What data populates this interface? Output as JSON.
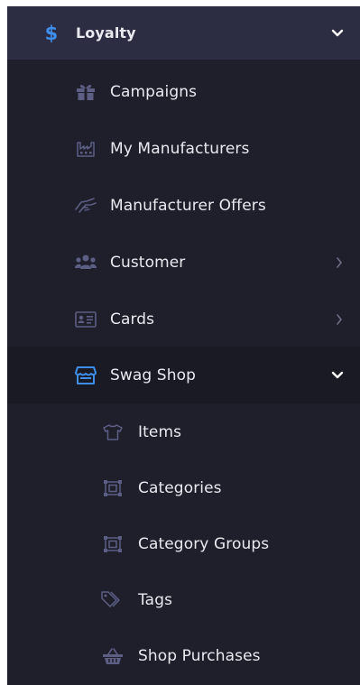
{
  "colors": {
    "panel_bg": "#1f1f2b",
    "header_bg": "#2c2c42",
    "selected_bg": "#1a1a25",
    "accent": "#3f8ee9",
    "icon_muted": "#5c5e84",
    "text": "#e9eaf0"
  },
  "loyalty": {
    "label": "Loyalty",
    "icon": "dollar-icon",
    "expanded": true
  },
  "items": [
    {
      "label": "Campaigns",
      "icon": "gift-icon"
    },
    {
      "label": "My Manufacturers",
      "icon": "factory-icon"
    },
    {
      "label": "Manufacturer Offers",
      "icon": "handshake-icon"
    },
    {
      "label": "Customer",
      "icon": "users-icon",
      "has_submenu": true
    },
    {
      "label": "Cards",
      "icon": "id-card-icon",
      "has_submenu": true
    },
    {
      "label": "Swag Shop",
      "icon": "store-icon",
      "expanded": true
    }
  ],
  "swag_shop_items": [
    {
      "label": "Items",
      "icon": "tshirt-icon"
    },
    {
      "label": "Categories",
      "icon": "category-icon"
    },
    {
      "label": "Category Groups",
      "icon": "category-icon"
    },
    {
      "label": "Tags",
      "icon": "tag-icon"
    },
    {
      "label": "Shop Purchases",
      "icon": "basket-icon"
    }
  ]
}
